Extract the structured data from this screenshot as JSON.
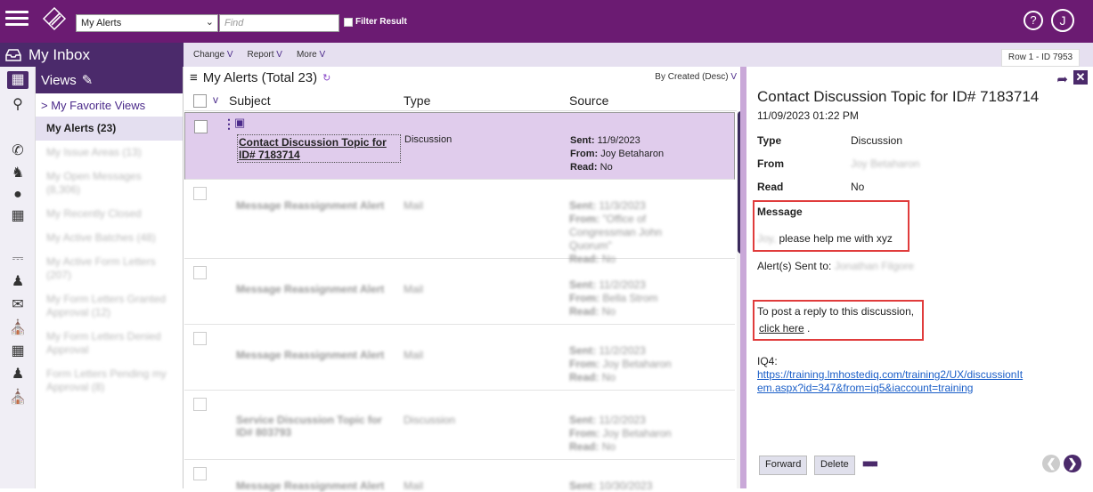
{
  "topbar": {
    "alert_select": "My Alerts",
    "find_placeholder": "Find",
    "filter_label": "Filter Result",
    "user_initial": "J",
    "help_glyph": "?"
  },
  "subheader": {
    "title": "My Inbox",
    "menu": [
      "Change",
      "Report",
      "More"
    ],
    "row_id": "Row 1 - ID 7953"
  },
  "nav": {
    "views_title": "Views",
    "favorite_views": "> My Favorite Views",
    "items": [
      "My Alerts (23)",
      "My Issue Areas (13)",
      "My Open Messages (8,306)",
      "My Recently Closed",
      "My Active Batches (48)",
      "My Active Form Letters (207)",
      "My Form Letters Granted Approval (12)",
      "My Form Letters Denied Approval",
      "Form Letters Pending my Approval (8)"
    ]
  },
  "list": {
    "title": "My Alerts (Total 23)",
    "sort": "By Created (Desc)",
    "columns": [
      "Subject",
      "Type",
      "Source"
    ],
    "rows": [
      {
        "subject": "Contact Discussion Topic for ID# 7183714",
        "type": "Discussion",
        "sent_label": "Sent:",
        "sent": "11/9/2023",
        "from_label": "From:",
        "from": "Joy Betaharon",
        "read_label": "Read:",
        "read": "No"
      },
      {
        "subject": "Message Reassignment Alert",
        "type": "Mail",
        "sent_label": "Sent:",
        "sent": "11/3/2023",
        "from_label": "From:",
        "from": "\"Office of Congressman John Quorum\"",
        "read_label": "Read:",
        "read": "No"
      },
      {
        "subject": "Message Reassignment Alert",
        "type": "Mail",
        "sent_label": "Sent:",
        "sent": "11/2/2023",
        "from_label": "From:",
        "from": "Bella Strom",
        "read_label": "Read:",
        "read": "No"
      },
      {
        "subject": "Message Reassignment Alert",
        "type": "Mail",
        "sent_label": "Sent:",
        "sent": "11/2/2023",
        "from_label": "From:",
        "from": "Joy Betaharon",
        "read_label": "Read:",
        "read": "No"
      },
      {
        "subject": "Service Discussion Topic for ID# 803793",
        "type": "Discussion",
        "sent_label": "Sent:",
        "sent": "11/2/2023",
        "from_label": "From:",
        "from": "Joy Betaharon",
        "read_label": "Read:",
        "read": "No"
      },
      {
        "subject": "Message Reassignment Alert",
        "type": "Mail",
        "sent_label": "Sent:",
        "sent": "10/30/2023",
        "from_label": "",
        "from": "",
        "read_label": "",
        "read": ""
      }
    ]
  },
  "detail": {
    "title": "Contact Discussion Topic for ID# 7183714",
    "date": "11/09/2023 01:22 PM",
    "type_label": "Type",
    "type": "Discussion",
    "from_label": "From",
    "from": "Joy Betaharon",
    "read_label": "Read",
    "read": "No",
    "message_label": "Message",
    "message_name": "Joy,",
    "message": "please help me with xyz",
    "sent_to_label": "Alert(s) Sent to:",
    "sent_to": "Jonathan Filgore",
    "reply_text": "To post a reply to this discussion,",
    "click_here": "click here",
    "iq4_label": "IQ4:",
    "iq4_link": "https://training.lmhostediq.com/training2/UX/discussionItem.aspx?id=347&from=iq5&iaccount=training",
    "forward": "Forward",
    "delete": "Delete"
  }
}
